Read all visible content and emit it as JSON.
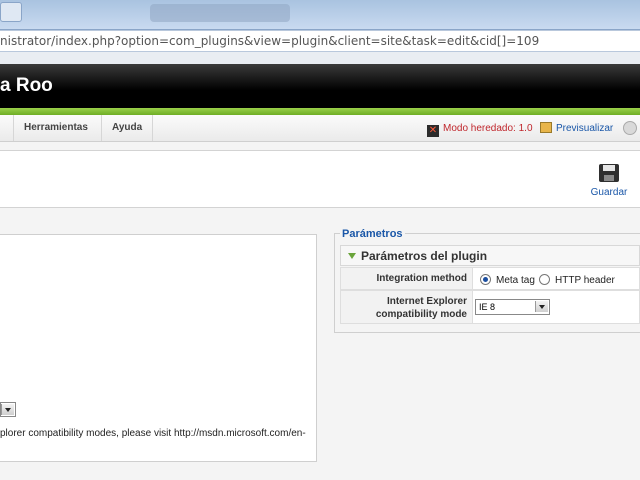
{
  "browser": {
    "url": "nistrator/index.php?option=com_plugins&view=plugin&client=site&task=edit&cid[]=109"
  },
  "header": {
    "site_title": "a Roo"
  },
  "menu": {
    "items": [
      "Herramientas",
      "Ayuda"
    ],
    "legacy_mode": "Modo heredado: 1.0",
    "preview": "Previsualizar"
  },
  "toolbar": {
    "save_label": "Guardar"
  },
  "left_panel": {
    "description": "plorer compatibility modes, please visit http://msdn.microsoft.com/en-"
  },
  "params": {
    "legend": "Parámetros",
    "section_title": "Parámetros del plugin",
    "integration_label": "Integration method",
    "option_meta": "Meta tag",
    "option_http": "HTTP header",
    "selected_method": "Meta tag",
    "ie_label_line1": "Internet Explorer",
    "ie_label_line2": "compatibility mode",
    "ie_value": "IE 8"
  },
  "colors": {
    "accent_green": "#6fae26",
    "link_blue": "#1a57a8",
    "legacy_red": "#c0272d"
  }
}
